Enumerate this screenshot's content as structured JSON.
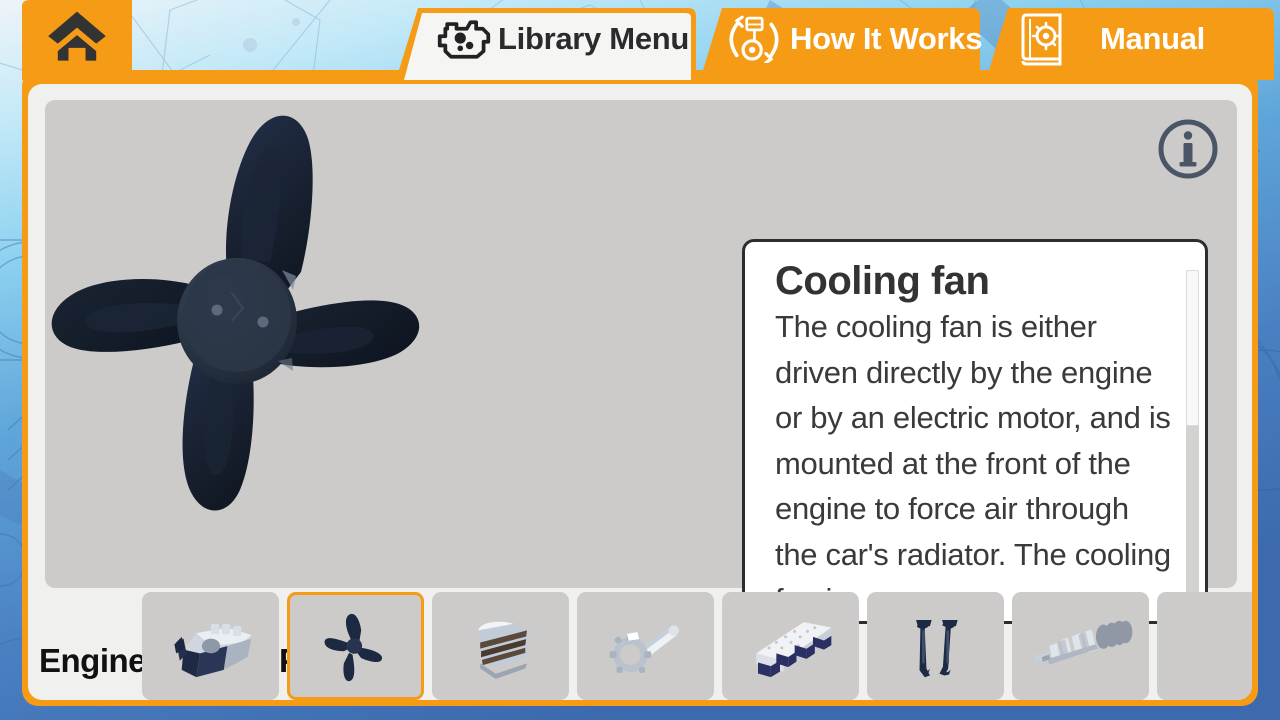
{
  "app": {
    "title": "Engine Parts Library"
  },
  "tabs": [
    {
      "id": "home",
      "label": "",
      "icon": "home-icon",
      "active": true,
      "style": "orange-square"
    },
    {
      "id": "library",
      "label": "Library Menu",
      "icon": "engine-gear-icon",
      "active": true,
      "style": "white-tab"
    },
    {
      "id": "howitworks",
      "label": "How It Works",
      "icon": "piston-loop-icon",
      "active": false,
      "style": "orange-tab"
    },
    {
      "id": "manual",
      "label": "Manual",
      "icon": "book-gear-icon",
      "active": false,
      "style": "orange-tab"
    }
  ],
  "viewport": {
    "model_name": "cooling-fan-3d-model",
    "info_button": {
      "icon": "info-icon",
      "label": "i"
    },
    "background_color": "#cdcbca"
  },
  "description": {
    "title": "Cooling fan",
    "body": "The cooling fan is either driven directly by the engine or by an electric motor, and is mounted at the front of the engine to force air through the car's radiator. The cooling fan is",
    "scroll_thumb_percent": 45
  },
  "strip": {
    "labels": [
      {
        "id": "engine",
        "text": "Engine"
      },
      {
        "id": "parts",
        "text": "Parts"
      }
    ],
    "thumbnails": [
      {
        "id": "engine-block",
        "icon": "v8-engine-icon",
        "selected": false
      },
      {
        "id": "cooling-fan",
        "icon": "cooling-fan-icon",
        "selected": true
      },
      {
        "id": "piston",
        "icon": "piston-icon",
        "selected": false
      },
      {
        "id": "connecting-rod",
        "icon": "connecting-rod-icon",
        "selected": false
      },
      {
        "id": "cylinder-head",
        "icon": "cylinder-head-icon",
        "selected": false
      },
      {
        "id": "valves",
        "icon": "valves-icon",
        "selected": false
      },
      {
        "id": "crankshaft",
        "icon": "crankshaft-icon",
        "selected": false
      },
      {
        "id": "next-part",
        "icon": "blank-icon",
        "selected": false
      }
    ]
  },
  "colors": {
    "accent_orange": "#F59B16",
    "panel_gray": "#f0f0ef",
    "viewport_gray": "#cdcbca",
    "tab_text_light": "#ffffff",
    "tab_text_dark": "#2b2b2b",
    "model_navy": "#1d2637"
  }
}
